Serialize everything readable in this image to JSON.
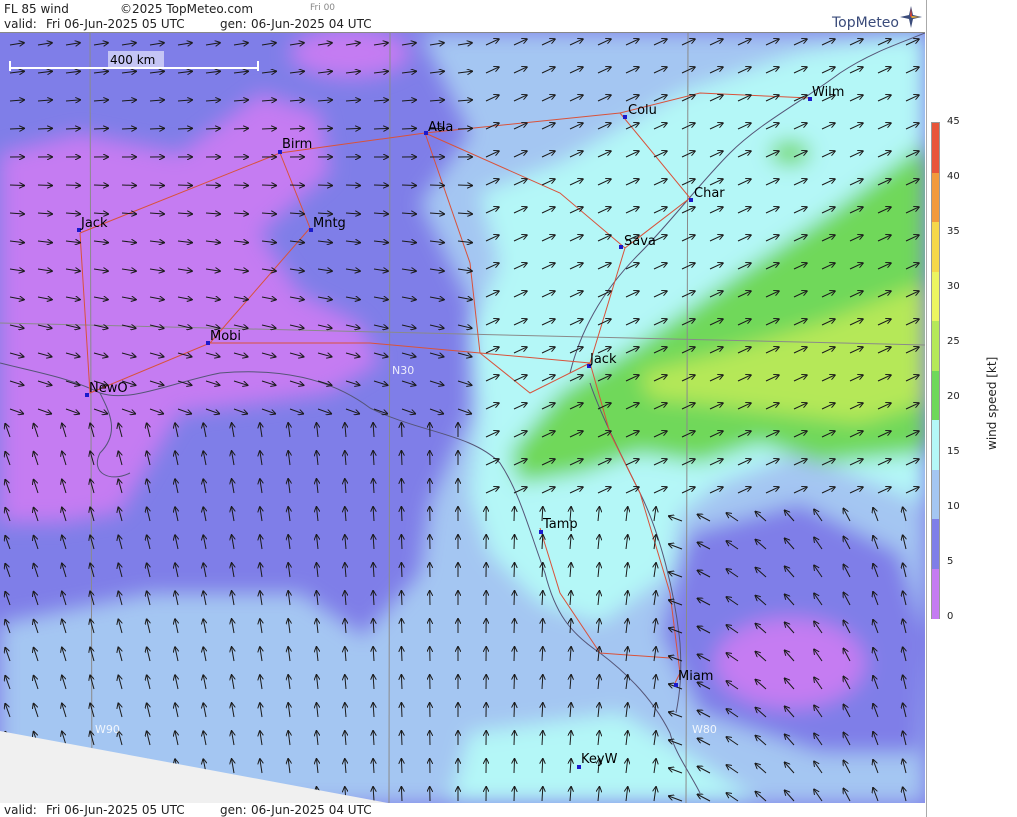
{
  "header": {
    "product": "FL 85 wind",
    "copyright": "©2025 TopMeteo.com",
    "frame": "Fri 00",
    "valid_label": "valid:",
    "valid_value": "Fri  06-Jun-2025  05 UTC",
    "gen_label": "gen:",
    "gen_value": "06-Jun-2025 04 UTC",
    "logo": "TopMeteo"
  },
  "scale_bar": {
    "label": "400 km"
  },
  "cities": [
    {
      "name": "Jack"
    },
    {
      "name": "Birm"
    },
    {
      "name": "Atla"
    },
    {
      "name": "Mntg"
    },
    {
      "name": "Mobi"
    },
    {
      "name": "NewO"
    },
    {
      "name": "Colu"
    },
    {
      "name": "Wilm"
    },
    {
      "name": "Char"
    },
    {
      "name": "Sava"
    },
    {
      "name": "Jack"
    },
    {
      "name": "Tamp"
    },
    {
      "name": "Miam"
    },
    {
      "name": "KeyW"
    }
  ],
  "grid_labels": {
    "lat": "N30",
    "lon1": "W90",
    "lon2": "W80"
  },
  "footer": {
    "valid_label": "valid:",
    "valid_value": "Fri  06-Jun-2025  05 UTC",
    "gen_label": "gen:",
    "gen_value": "06-Jun-2025 04 UTC"
  },
  "colorbar": {
    "label": "wind speed  [kt]",
    "ticks": [
      "45",
      "40",
      "35",
      "30",
      "25",
      "20",
      "15",
      "10",
      "5",
      "0"
    ],
    "colors": [
      "#e8553a",
      "#f29a3c",
      "#f6d84a",
      "#ecf560",
      "#b5e858",
      "#6fd85a",
      "#b4f7f7",
      "#a4c6f2",
      "#7f7ee8",
      "#c57bf2"
    ]
  }
}
